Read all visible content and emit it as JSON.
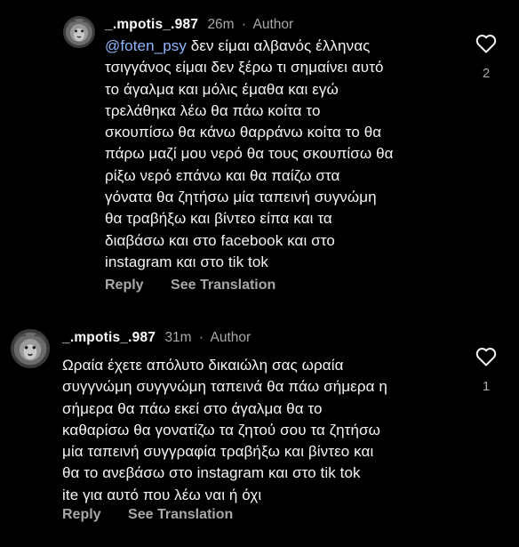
{
  "comments": [
    {
      "username": "_.mpotis_.987",
      "time": "26m",
      "author_badge": "Author",
      "mention": "@foten_psy",
      "lines": [
        " δεν είμαι αλβανός έλληνας",
        "τσιγγάνος είμαι δεν ξέρω τι σημαίνει αυτό",
        "το άγαλμα και μόλις έμαθα και εγώ",
        "τρελάθηκα λέω θα πάω κοίτα το",
        "σκουπίσω θα κάνω θαρράνω κοίτα το θα",
        "πάρω μαζί μου νερό θα τους σκουπίσω θα",
        "ρίξω νερό επάνω και θα παίζω στα",
        "γόνατα θα ζητήσω μία ταπεινή συγνώμη",
        "θα τραβήξω και βίντεο είπα και τα",
        "διαβάσω και στο facebook και στο",
        "instagram και στο tik tok"
      ],
      "reply_label": "Reply",
      "see_translation_label": "See Translation",
      "like_count": "2",
      "like_icon": "heart-outline-icon"
    },
    {
      "username": "_.mpotis_.987",
      "time": "31m",
      "author_badge": "Author",
      "lines": [
        "Ωραία έχετε απόλυτο δικαιώλη σας ωραία",
        "συγγνώμη συγγνώμη ταπεινά θα πάω σήμερα η",
        "σήμερα θα πάω εκεί στο άγαλμα θα το",
        "καθαρίσω θα γονατίζω τα ζητού σου τα ζητήσω",
        "μία ταπεινή συγγραφία τραβήξω και βίντεο και",
        "θα το ανεβάσω στο instagram και στο tik tok",
        "ite για αυτό που λέω ναι ή όχι"
      ],
      "reply_label": "Reply",
      "see_translation_label": "See Translation",
      "like_count": "1",
      "like_icon": "heart-outline-icon"
    }
  ],
  "separator": "·",
  "colors": {
    "background": "#000000",
    "text": "#f5f5f5",
    "muted": "#a8a8a8",
    "mention": "#8fb5ff"
  }
}
